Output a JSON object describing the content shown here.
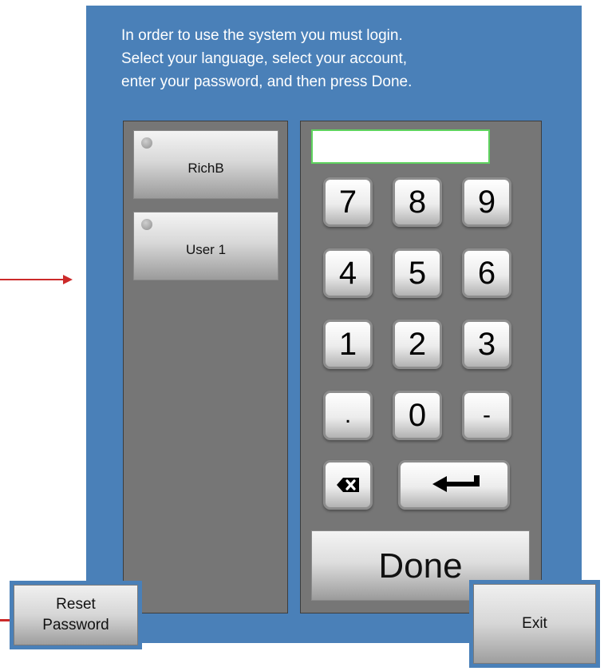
{
  "instructions": "In order to use the system you must login.\nSelect your language, select your account,\nenter your password, and then press Done.",
  "accounts": [
    {
      "label": "RichB",
      "selected": false
    },
    {
      "label": "User 1",
      "selected": false
    }
  ],
  "password": {
    "value": "",
    "placeholder": ""
  },
  "keypad": {
    "keys": [
      "7",
      "8",
      "9",
      "4",
      "5",
      "6",
      "1",
      "2",
      "3",
      ".",
      "0",
      "-"
    ],
    "backspace_icon": "backspace-icon",
    "enter_icon": "enter-arrow-icon"
  },
  "done_label": "Done",
  "reset_label": "Reset\nPassword",
  "exit_label": "Exit",
  "colors": {
    "panel_blue": "#4a80b8",
    "panel_gray": "#767676",
    "field_border": "#5fd35f",
    "annotation_red": "#cc2a2a"
  }
}
